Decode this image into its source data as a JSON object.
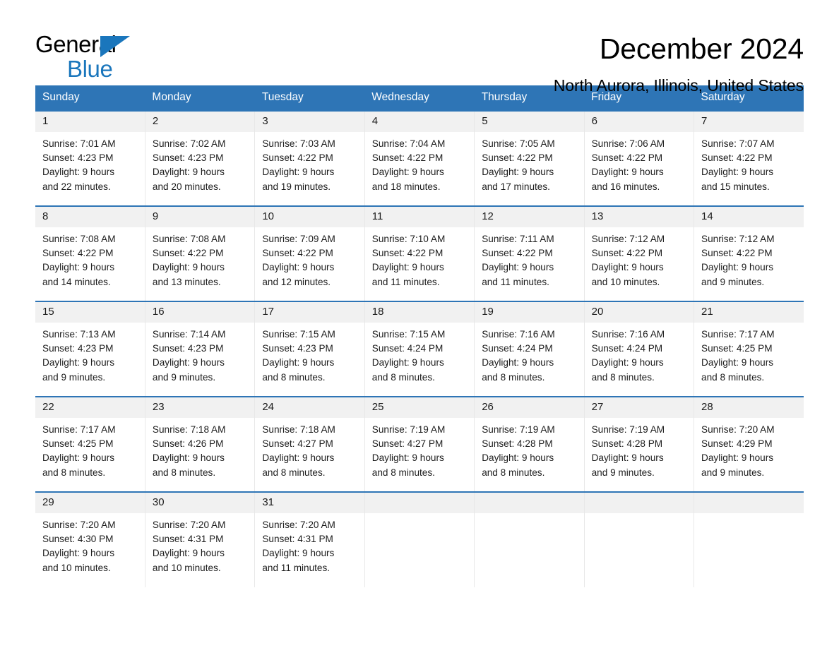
{
  "brand": {
    "name_top": "General",
    "name_bottom": "Blue",
    "accent_color": "#1a76bc"
  },
  "header": {
    "title": "December 2024",
    "location": "North Aurora, Illinois, United States",
    "header_bg_color": "#2e75b6",
    "daynum_bg_color": "#f1f1f1"
  },
  "weekday_headers": [
    "Sunday",
    "Monday",
    "Tuesday",
    "Wednesday",
    "Thursday",
    "Friday",
    "Saturday"
  ],
  "weeks": [
    [
      {
        "day": "1",
        "info": "Sunrise: 7:01 AM\nSunset: 4:23 PM\nDaylight: 9 hours\nand 22 minutes."
      },
      {
        "day": "2",
        "info": "Sunrise: 7:02 AM\nSunset: 4:23 PM\nDaylight: 9 hours\nand 20 minutes."
      },
      {
        "day": "3",
        "info": "Sunrise: 7:03 AM\nSunset: 4:22 PM\nDaylight: 9 hours\nand 19 minutes."
      },
      {
        "day": "4",
        "info": "Sunrise: 7:04 AM\nSunset: 4:22 PM\nDaylight: 9 hours\nand 18 minutes."
      },
      {
        "day": "5",
        "info": "Sunrise: 7:05 AM\nSunset: 4:22 PM\nDaylight: 9 hours\nand 17 minutes."
      },
      {
        "day": "6",
        "info": "Sunrise: 7:06 AM\nSunset: 4:22 PM\nDaylight: 9 hours\nand 16 minutes."
      },
      {
        "day": "7",
        "info": "Sunrise: 7:07 AM\nSunset: 4:22 PM\nDaylight: 9 hours\nand 15 minutes."
      }
    ],
    [
      {
        "day": "8",
        "info": "Sunrise: 7:08 AM\nSunset: 4:22 PM\nDaylight: 9 hours\nand 14 minutes."
      },
      {
        "day": "9",
        "info": "Sunrise: 7:08 AM\nSunset: 4:22 PM\nDaylight: 9 hours\nand 13 minutes."
      },
      {
        "day": "10",
        "info": "Sunrise: 7:09 AM\nSunset: 4:22 PM\nDaylight: 9 hours\nand 12 minutes."
      },
      {
        "day": "11",
        "info": "Sunrise: 7:10 AM\nSunset: 4:22 PM\nDaylight: 9 hours\nand 11 minutes."
      },
      {
        "day": "12",
        "info": "Sunrise: 7:11 AM\nSunset: 4:22 PM\nDaylight: 9 hours\nand 11 minutes."
      },
      {
        "day": "13",
        "info": "Sunrise: 7:12 AM\nSunset: 4:22 PM\nDaylight: 9 hours\nand 10 minutes."
      },
      {
        "day": "14",
        "info": "Sunrise: 7:12 AM\nSunset: 4:22 PM\nDaylight: 9 hours\nand 9 minutes."
      }
    ],
    [
      {
        "day": "15",
        "info": "Sunrise: 7:13 AM\nSunset: 4:23 PM\nDaylight: 9 hours\nand 9 minutes."
      },
      {
        "day": "16",
        "info": "Sunrise: 7:14 AM\nSunset: 4:23 PM\nDaylight: 9 hours\nand 9 minutes."
      },
      {
        "day": "17",
        "info": "Sunrise: 7:15 AM\nSunset: 4:23 PM\nDaylight: 9 hours\nand 8 minutes."
      },
      {
        "day": "18",
        "info": "Sunrise: 7:15 AM\nSunset: 4:24 PM\nDaylight: 9 hours\nand 8 minutes."
      },
      {
        "day": "19",
        "info": "Sunrise: 7:16 AM\nSunset: 4:24 PM\nDaylight: 9 hours\nand 8 minutes."
      },
      {
        "day": "20",
        "info": "Sunrise: 7:16 AM\nSunset: 4:24 PM\nDaylight: 9 hours\nand 8 minutes."
      },
      {
        "day": "21",
        "info": "Sunrise: 7:17 AM\nSunset: 4:25 PM\nDaylight: 9 hours\nand 8 minutes."
      }
    ],
    [
      {
        "day": "22",
        "info": "Sunrise: 7:17 AM\nSunset: 4:25 PM\nDaylight: 9 hours\nand 8 minutes."
      },
      {
        "day": "23",
        "info": "Sunrise: 7:18 AM\nSunset: 4:26 PM\nDaylight: 9 hours\nand 8 minutes."
      },
      {
        "day": "24",
        "info": "Sunrise: 7:18 AM\nSunset: 4:27 PM\nDaylight: 9 hours\nand 8 minutes."
      },
      {
        "day": "25",
        "info": "Sunrise: 7:19 AM\nSunset: 4:27 PM\nDaylight: 9 hours\nand 8 minutes."
      },
      {
        "day": "26",
        "info": "Sunrise: 7:19 AM\nSunset: 4:28 PM\nDaylight: 9 hours\nand 8 minutes."
      },
      {
        "day": "27",
        "info": "Sunrise: 7:19 AM\nSunset: 4:28 PM\nDaylight: 9 hours\nand 9 minutes."
      },
      {
        "day": "28",
        "info": "Sunrise: 7:20 AM\nSunset: 4:29 PM\nDaylight: 9 hours\nand 9 minutes."
      }
    ],
    [
      {
        "day": "29",
        "info": "Sunrise: 7:20 AM\nSunset: 4:30 PM\nDaylight: 9 hours\nand 10 minutes."
      },
      {
        "day": "30",
        "info": "Sunrise: 7:20 AM\nSunset: 4:31 PM\nDaylight: 9 hours\nand 10 minutes."
      },
      {
        "day": "31",
        "info": "Sunrise: 7:20 AM\nSunset: 4:31 PM\nDaylight: 9 hours\nand 11 minutes."
      },
      {
        "day": "",
        "info": ""
      },
      {
        "day": "",
        "info": ""
      },
      {
        "day": "",
        "info": ""
      },
      {
        "day": "",
        "info": ""
      }
    ]
  ]
}
